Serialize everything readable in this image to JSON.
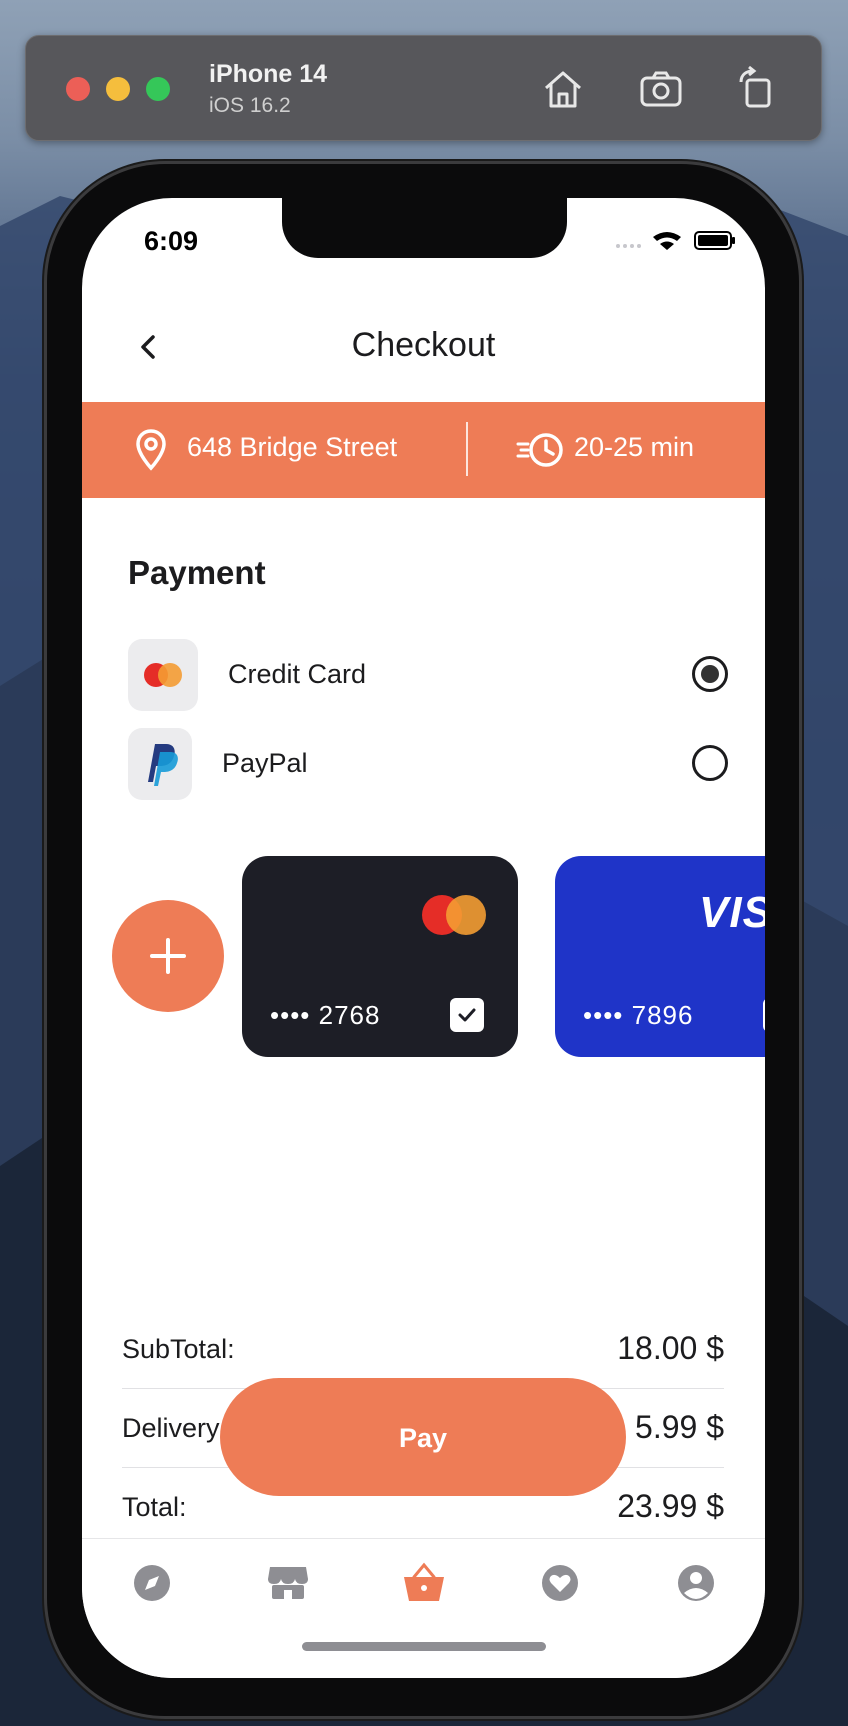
{
  "simulator": {
    "device": "iPhone 14",
    "os": "iOS 16.2",
    "window_dot_colors": [
      "#ec5f57",
      "#f5be3d",
      "#35c759"
    ]
  },
  "status_bar": {
    "time": "6:09"
  },
  "header": {
    "title": "Checkout",
    "back_icon": "chevron-left-icon"
  },
  "delivery": {
    "address": "648 Bridge Street",
    "eta": "20-25 min",
    "accent": "#ee7c56"
  },
  "payment": {
    "title": "Payment",
    "methods": [
      {
        "label": "Credit Card",
        "icon": "mastercard-icon",
        "selected": true
      },
      {
        "label": "PayPal",
        "icon": "paypal-icon",
        "selected": false
      }
    ]
  },
  "cards": [
    {
      "brand": "mastercard",
      "masked": "•••• 2768",
      "color": "#1d1e26",
      "selected": true
    },
    {
      "brand": "visa",
      "brand_text": "VIS",
      "masked": "•••• 7896",
      "color": "#1f34c8",
      "selected": false
    }
  ],
  "summary": {
    "rows": [
      {
        "label": "SubTotal:",
        "value": "18.00 $"
      },
      {
        "label": "Delivery:",
        "value": "5.99 $"
      },
      {
        "label": "Total:",
        "value": "23.99 $"
      }
    ]
  },
  "pay_button": {
    "label": "Pay"
  },
  "tabbar": {
    "items": [
      {
        "icon": "compass-icon",
        "active": false
      },
      {
        "icon": "store-icon",
        "active": false
      },
      {
        "icon": "basket-icon",
        "active": true
      },
      {
        "icon": "heart-icon",
        "active": false
      },
      {
        "icon": "profile-icon",
        "active": false
      }
    ],
    "active_color": "#ee7c56",
    "inactive_color": "#8e8e93"
  }
}
